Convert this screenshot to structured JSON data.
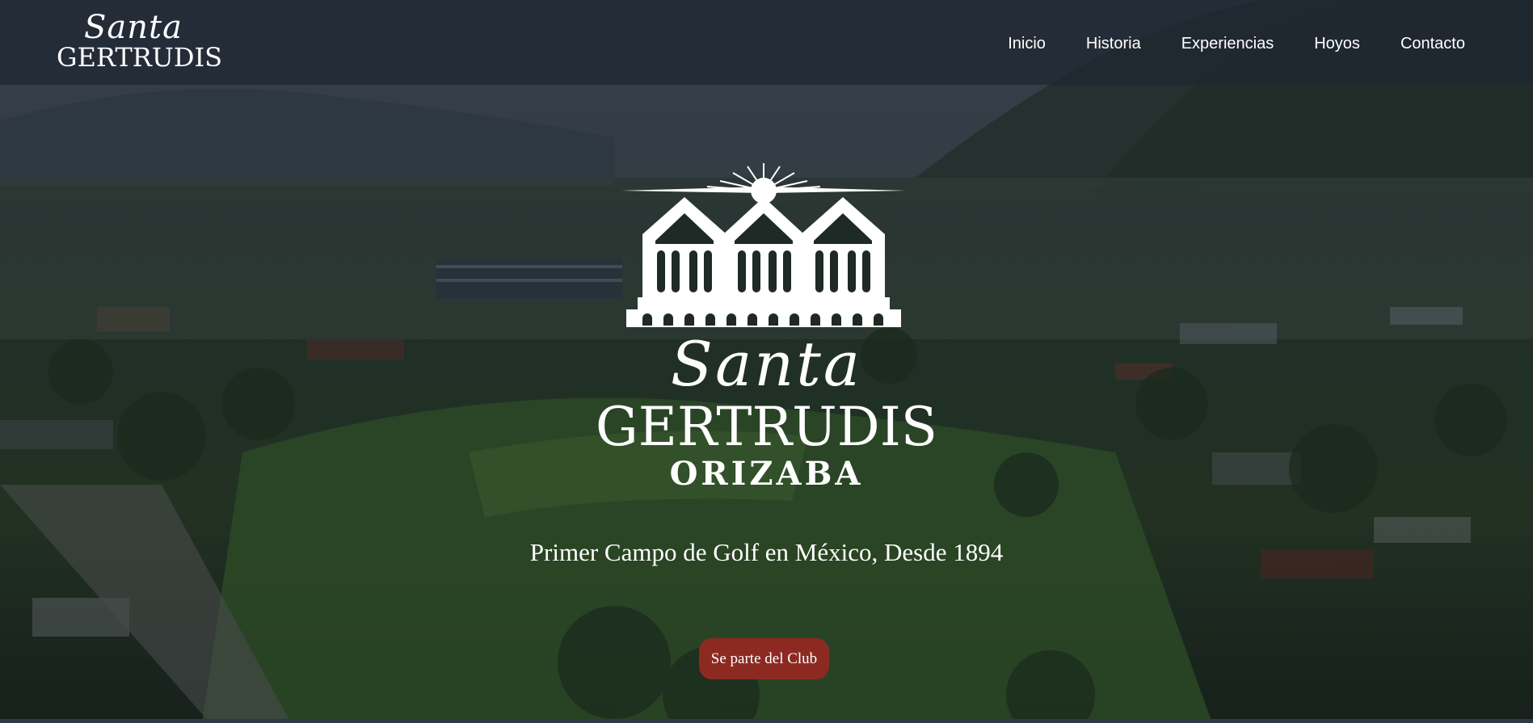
{
  "header": {
    "logo": {
      "line1": "Santa",
      "line2": "GERTRUDIS"
    },
    "nav": [
      {
        "label": "Inicio"
      },
      {
        "label": "Historia"
      },
      {
        "label": "Experiencias"
      },
      {
        "label": "Hoyos"
      },
      {
        "label": "Contacto"
      }
    ]
  },
  "hero": {
    "brand": {
      "line1": "Santa",
      "line2": "GERTRUDIS",
      "line3": "ORIZABA"
    },
    "tagline": "Primer Campo de Golf en México, Desde 1894",
    "cta_label": "Se parte del Club"
  },
  "colors": {
    "cta_background": "#8c2a22",
    "navbar_background": "#1e2632",
    "text": "#ffffff"
  },
  "icons": {
    "hero_emblem": "hacienda-sun-emblem-icon"
  }
}
